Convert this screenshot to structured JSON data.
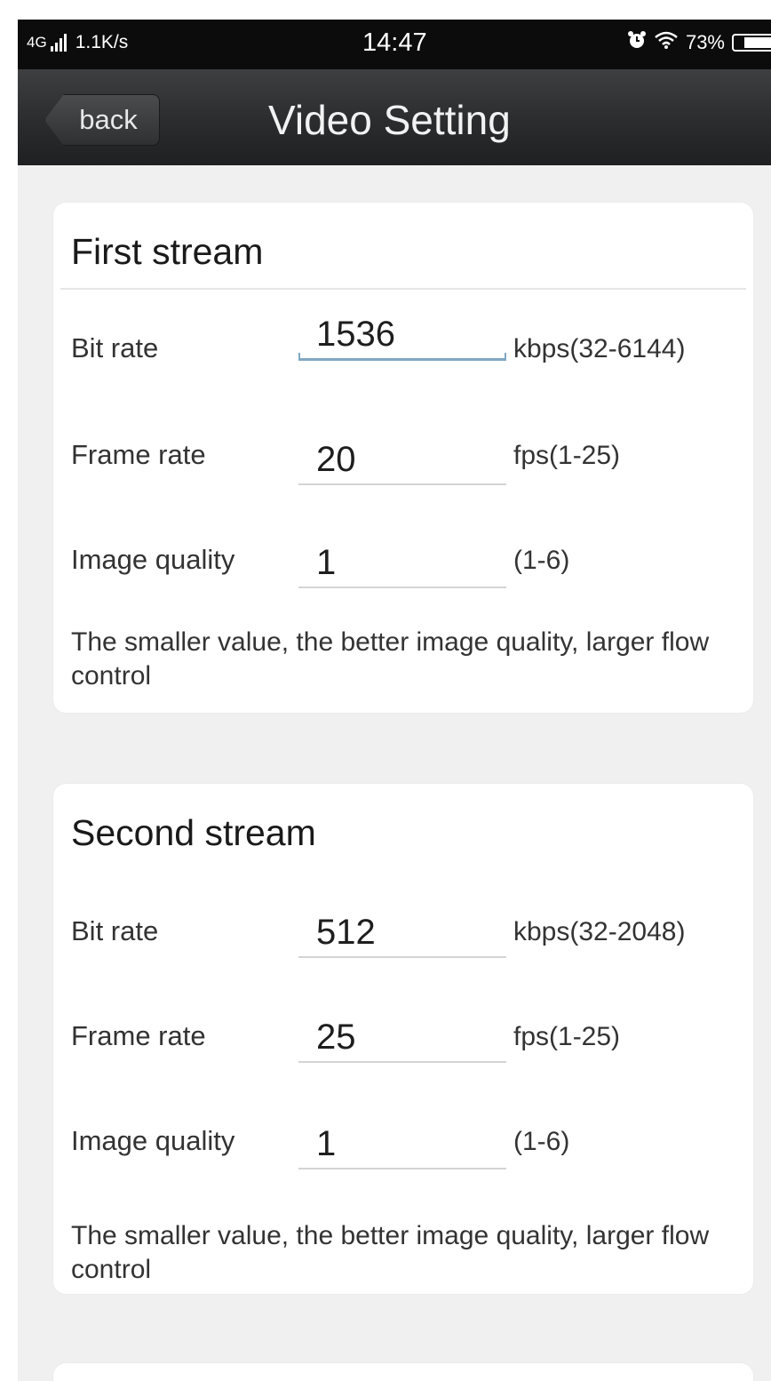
{
  "status_bar": {
    "network": "4G",
    "speed": "1.1K/s",
    "time": "14:47",
    "alarm_icon": "alarm-icon",
    "wifi_icon": "wifi-icon",
    "battery": "73%"
  },
  "nav": {
    "back_label": "back",
    "title": "Video Setting"
  },
  "first_stream": {
    "title": "First stream",
    "bit_rate": {
      "label": "Bit rate",
      "value": "1536",
      "unit": "kbps(32-6144)"
    },
    "frame_rate": {
      "label": "Frame rate",
      "value": "20",
      "unit": "fps(1-25)"
    },
    "image_quality": {
      "label": "Image quality",
      "value": "1",
      "unit": "(1-6)"
    },
    "note": "The smaller value, the better image quality, larger flow control"
  },
  "second_stream": {
    "title": "Second stream",
    "bit_rate": {
      "label": "Bit rate",
      "value": "512",
      "unit": "kbps(32-2048)"
    },
    "frame_rate": {
      "label": "Frame rate",
      "value": "25",
      "unit": "fps(1-25)"
    },
    "image_quality": {
      "label": "Image quality",
      "value": "1",
      "unit": "(1-6)"
    },
    "note": "The smaller value, the better image quality, larger flow control"
  },
  "colors": {
    "status_bar_bg": "#0c0c0c",
    "nav_bar_bg": "#2a2c2d",
    "page_bg": "#f0f0f0",
    "card_bg": "#ffffff",
    "focus_underline": "#7fa8c4"
  }
}
